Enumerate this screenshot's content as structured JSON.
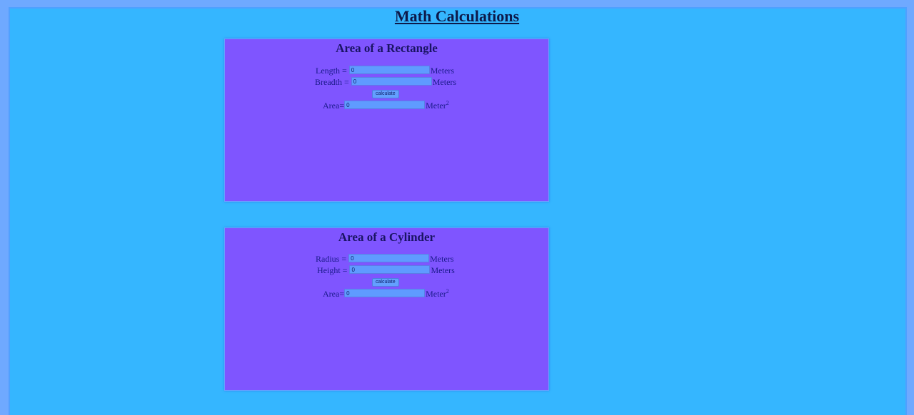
{
  "page": {
    "title": "Math Calculations"
  },
  "rectangle": {
    "title": "Area of a Rectangle",
    "length_label": "Length =",
    "length_value": "0",
    "length_unit": "Meters",
    "breadth_label": "Breadth =",
    "breadth_value": "0",
    "breadth_unit": "Meters",
    "calculate_label": "calculate",
    "area_label": "Area=",
    "area_value": "0",
    "area_unit": "Meter",
    "area_unit_exp": "2"
  },
  "cylinder": {
    "title": "Area of a Cylinder",
    "radius_label": "Radius =",
    "radius_value": "0",
    "radius_unit": "Meters",
    "height_label": "Height =",
    "height_value": "0",
    "height_unit": "Meters",
    "calculate_label": "calculate",
    "area_label": "Area=",
    "area_value": "0",
    "area_unit": "Meter",
    "area_unit_exp": "2"
  },
  "colors": {
    "background": "#35b6ff",
    "panel": "#7f55ff",
    "input": "#5f9bff",
    "title_text": "#0d1a4a"
  }
}
